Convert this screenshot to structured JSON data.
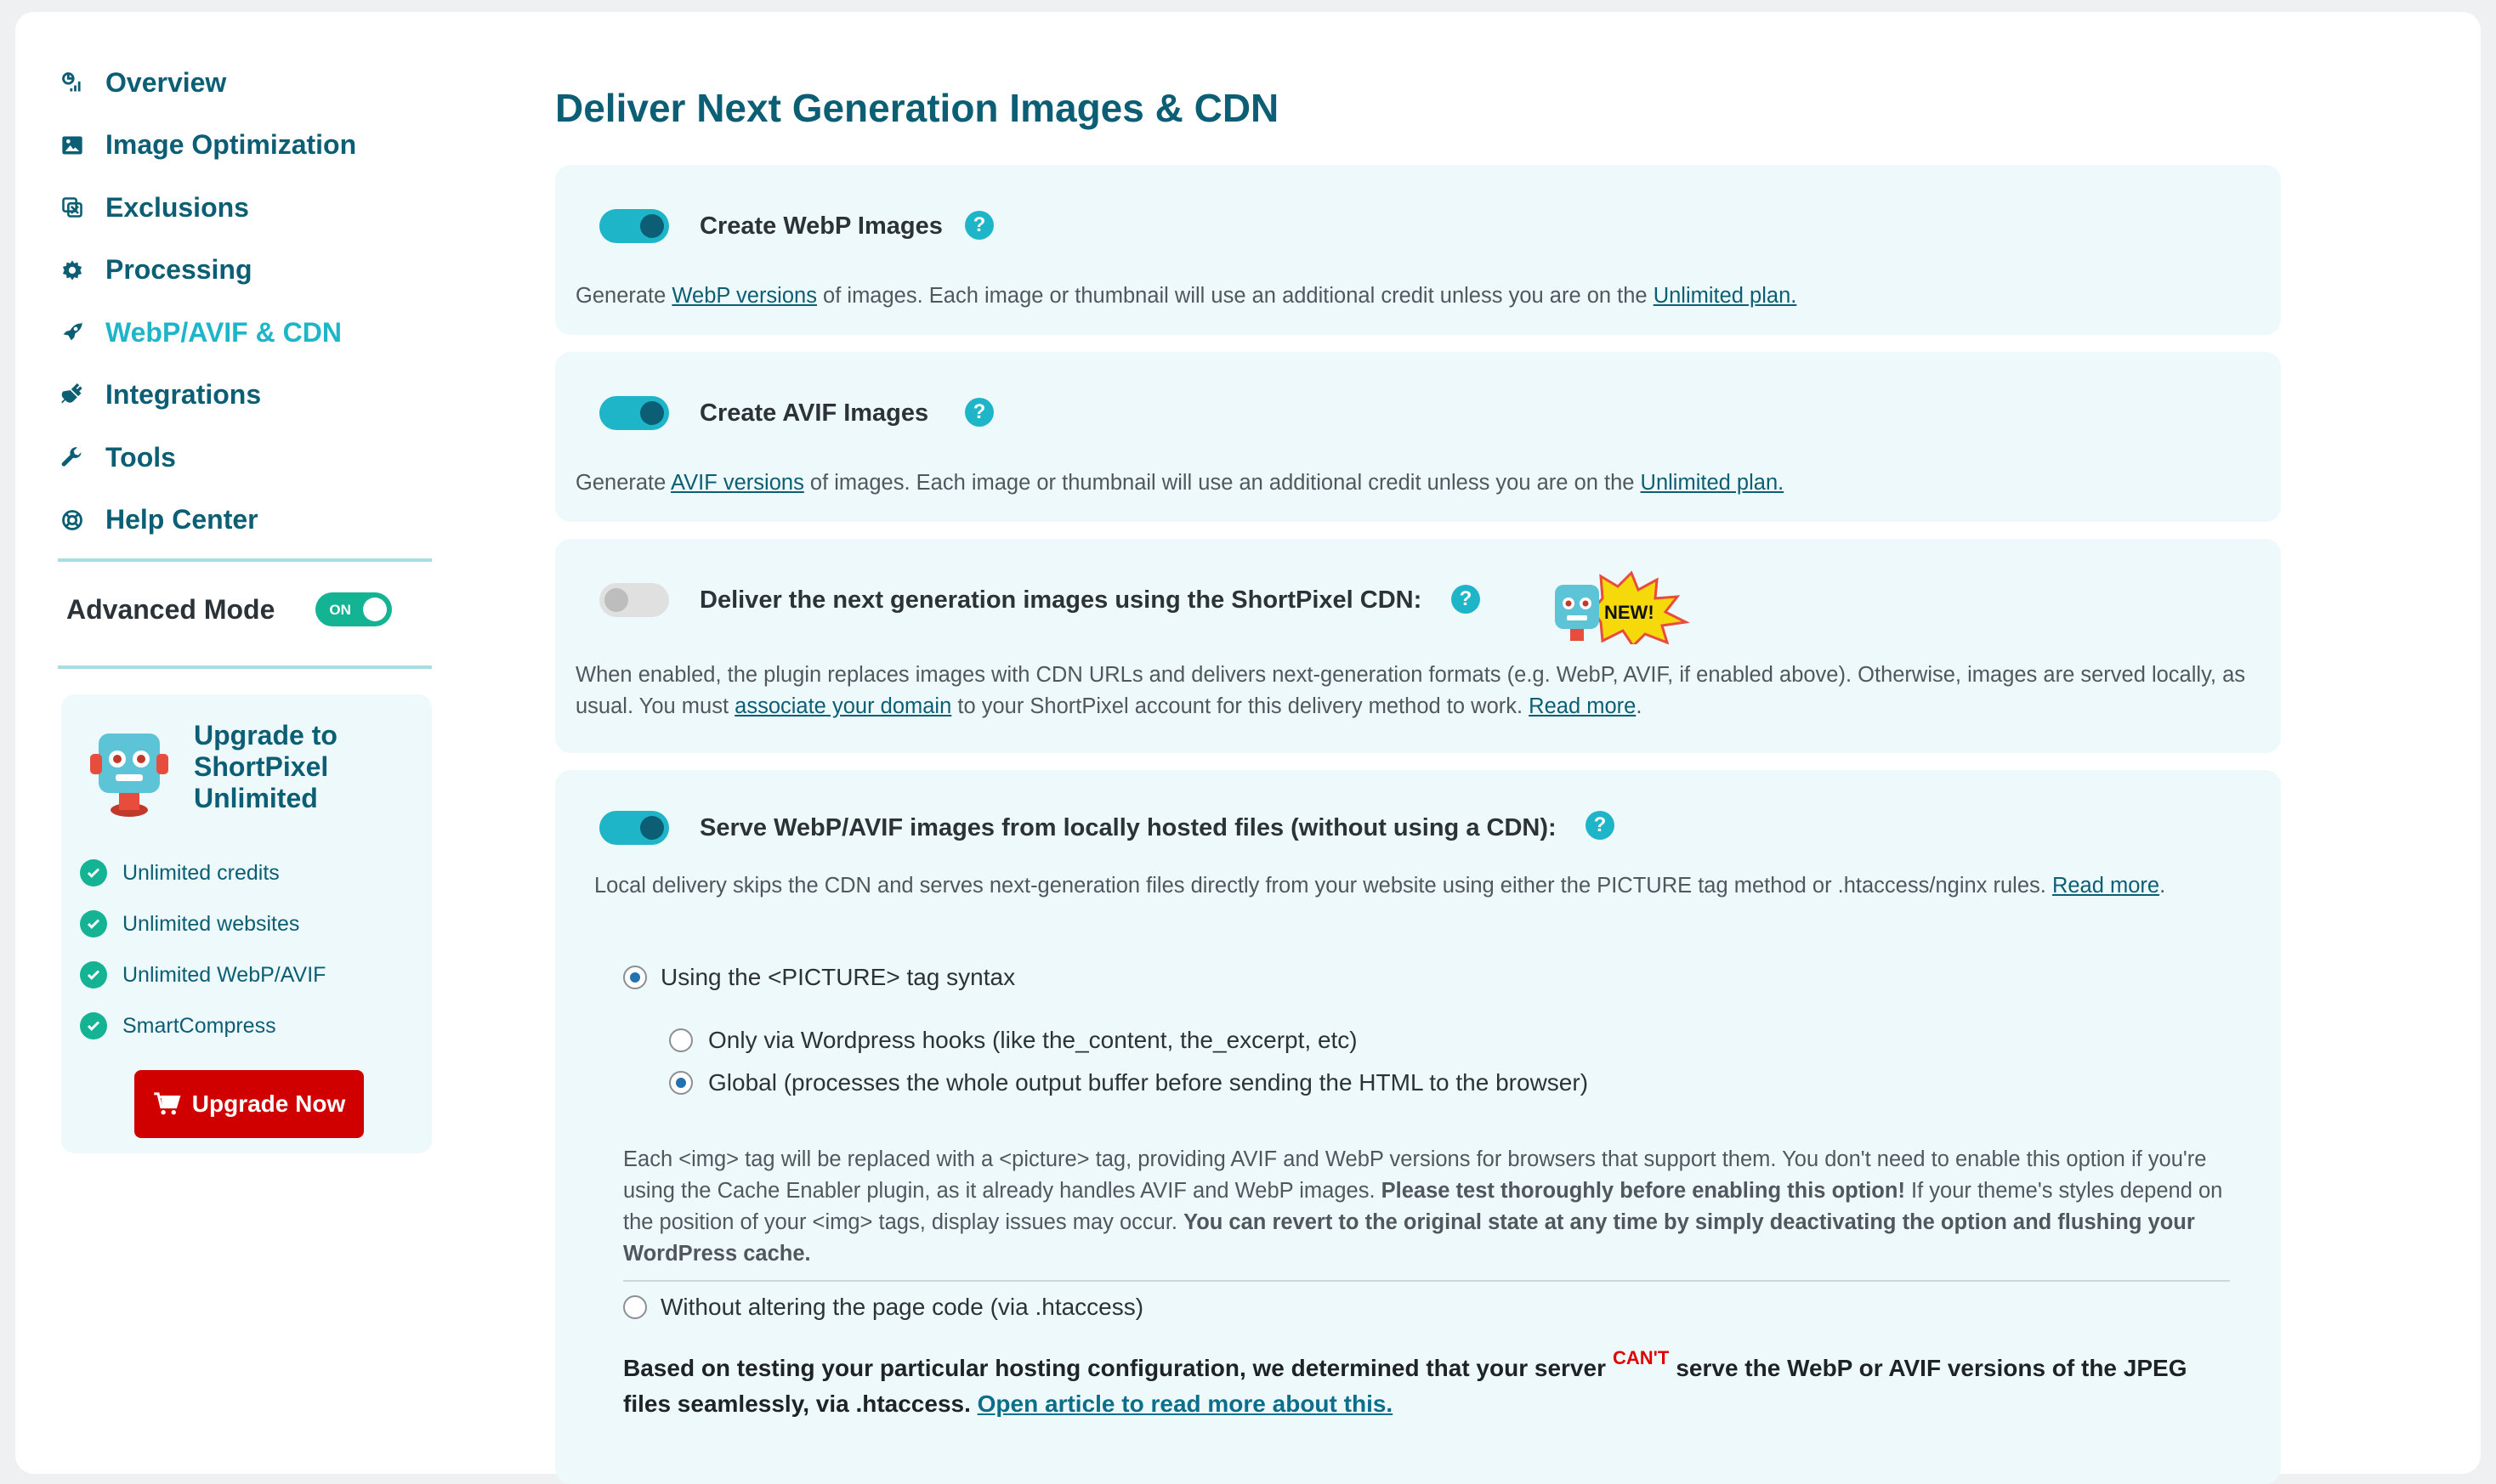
{
  "sidebar": {
    "items": [
      {
        "label": "Overview",
        "icon": "chart-pie-icon"
      },
      {
        "label": "Image Optimization",
        "icon": "image-icon"
      },
      {
        "label": "Exclusions",
        "icon": "exclusions-icon"
      },
      {
        "label": "Processing",
        "icon": "gear-icon"
      },
      {
        "label": "WebP/AVIF & CDN",
        "icon": "rocket-icon"
      },
      {
        "label": "Integrations",
        "icon": "plug-icon"
      },
      {
        "label": "Tools",
        "icon": "wrench-icon"
      },
      {
        "label": "Help Center",
        "icon": "lifebuoy-icon"
      }
    ],
    "active_item": "WebP/AVIF & CDN",
    "advanced_mode": {
      "label": "Advanced Mode",
      "toggle_text": "ON",
      "enabled": true
    },
    "upgrade": {
      "title": "Upgrade to ShortPixel Unlimited",
      "features": [
        "Unlimited credits",
        "Unlimited websites",
        "Unlimited WebP/AVIF",
        "SmartCompress"
      ],
      "button": "Upgrade Now"
    }
  },
  "main": {
    "title": "Deliver Next Generation Images & CDN",
    "webp": {
      "title": "Create WebP Images",
      "enabled": true,
      "desc_pre": "Generate ",
      "desc_link": "WebP versions",
      "desc_mid": " of images. Each image or thumbnail will use an additional credit unless you are on the ",
      "desc_link2": "Unlimited plan."
    },
    "avif": {
      "title": "Create AVIF Images",
      "enabled": true,
      "desc_pre": "Generate ",
      "desc_link": "AVIF versions",
      "desc_mid": " of images. Each image or thumbnail will use an additional credit unless you are on the ",
      "desc_link2": "Unlimited plan."
    },
    "cdn": {
      "title": "Deliver the next generation images using the ShortPixel CDN:",
      "enabled": false,
      "badge": "NEW!",
      "desc_1": "When enabled, the plugin replaces images with CDN URLs and delivers next-generation formats (e.g. WebP, AVIF, if enabled above). Otherwise, images are served locally, as usual. You must ",
      "desc_link": "associate your domain",
      "desc_2": " to your ShortPixel account for this delivery method to work. ",
      "desc_link2": "Read more",
      "desc_3": "."
    },
    "local": {
      "title": "Serve WebP/AVIF images from locally hosted files (without using a CDN):",
      "enabled": true,
      "desc_1": "Local delivery skips the CDN and serves next-generation files directly from your website using either the PICTURE tag method or .htaccess/nginx rules. ",
      "desc_link": "Read more",
      "desc_2": ".",
      "option_picture": "Using the <PICTURE> tag syntax",
      "option_hooks": "Only via Wordpress hooks (like the_content, the_excerpt, etc)",
      "option_global": "Global (processes the whole output buffer before sending the HTML to the browser)",
      "picture_note_1": "Each <img> tag will be replaced with a <picture> tag, providing AVIF and WebP versions for browsers that support them. You don't need to enable this option if you're using the Cache Enabler plugin, as it already handles AVIF and WebP images. ",
      "picture_note_bold_1": "Please test thoroughly before enabling this option!",
      "picture_note_2": " If your theme's styles depend on the position of your <img> tags, display issues may occur. ",
      "picture_note_bold_2": "You can revert to the original state at any time by simply deactivating the option and flushing your WordPress cache.",
      "option_htaccess": "Without altering the page code (via .htaccess)",
      "server_note_1": "Based on testing your particular hosting configuration, we determined that your server",
      "server_cant": "CAN'T",
      "server_note_2": "serve the WebP or AVIF versions of the JPEG files seamlessly, via .htaccess. ",
      "server_link": "Open article to read more about this."
    }
  },
  "colors": {
    "primary": "#0b5e73",
    "accent": "#1fb5c9",
    "success": "#13b394",
    "danger": "#d10000",
    "card_bg": "#eef9fb"
  }
}
